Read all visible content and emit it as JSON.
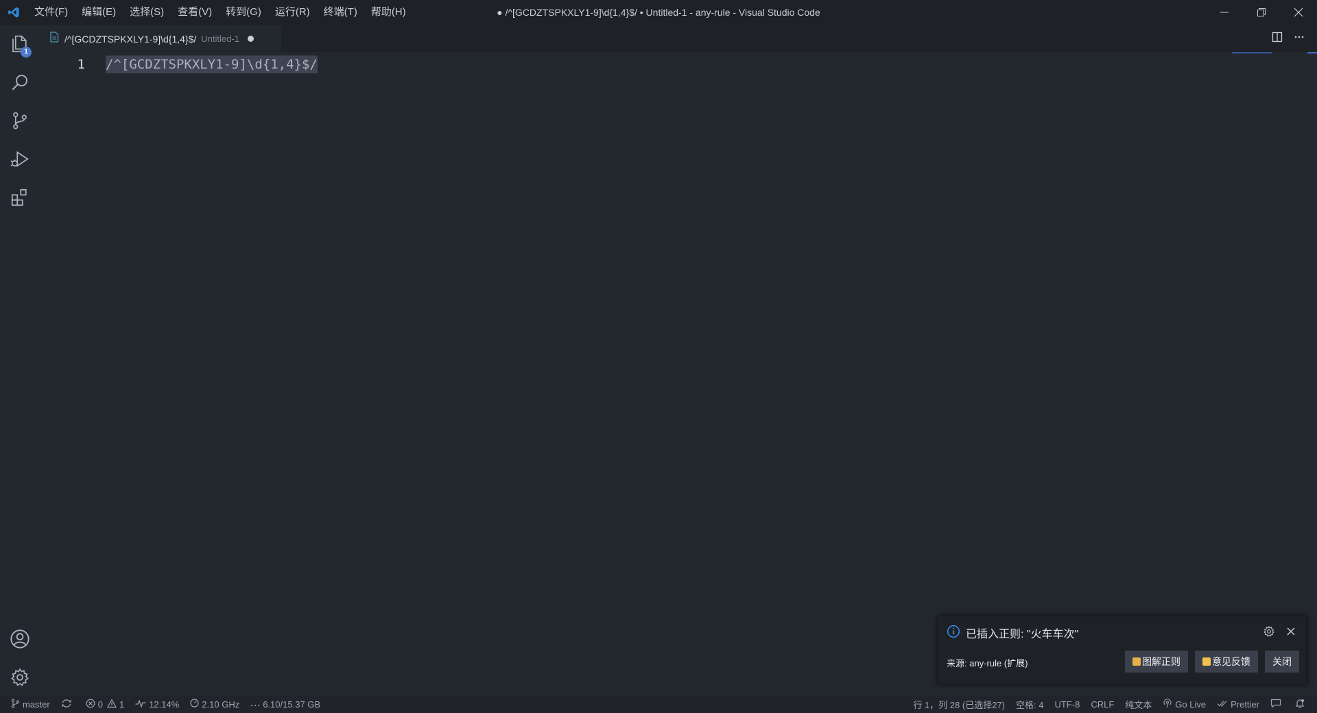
{
  "app": {
    "window_title": "● /^[GCDZTSPKXLY1-9]\\d{1,4}$/ • Untitled-1 - any-rule - Visual Studio Code",
    "accent": "#3e6ec8",
    "logo_icon": "vscode-logo-icon"
  },
  "menu": [
    "文件(F)",
    "编辑(E)",
    "选择(S)",
    "查看(V)",
    "转到(G)",
    "运行(R)",
    "终端(T)",
    "帮助(H)"
  ],
  "activity_bar": {
    "explorer_badge": "1",
    "items": [
      "files-icon",
      "search-icon",
      "source-control-icon",
      "run-debug-icon",
      "extensions-icon"
    ],
    "bottom_items": [
      "account-icon",
      "settings-gear-icon"
    ]
  },
  "tab": {
    "title": "/^[GCDZTSPKXLY1-9]\\d{1,4}$/",
    "description": "Untitled-1"
  },
  "editor": {
    "line_number": "1",
    "code": "/^[GCDZTSPKXLY1-9]\\d{1,4}$/"
  },
  "notification": {
    "message": "已插入正则: \"火车车次\"",
    "source": "来源: any-rule (扩展)",
    "buttons": [
      "图解正则",
      "意见反馈",
      "关闭"
    ]
  },
  "statusbar": {
    "branch": "master",
    "errors": "0",
    "warnings": "1",
    "cpu": "12.14%",
    "freq": "2.10 GHz",
    "memory": "6.10/15.37 GB",
    "position": "行 1，列 28 (已选择27)",
    "indent": "空格: 4",
    "encoding": "UTF-8",
    "eol": "CRLF",
    "language": "纯文本",
    "golive": "Go Live",
    "prettier": "Prettier"
  }
}
